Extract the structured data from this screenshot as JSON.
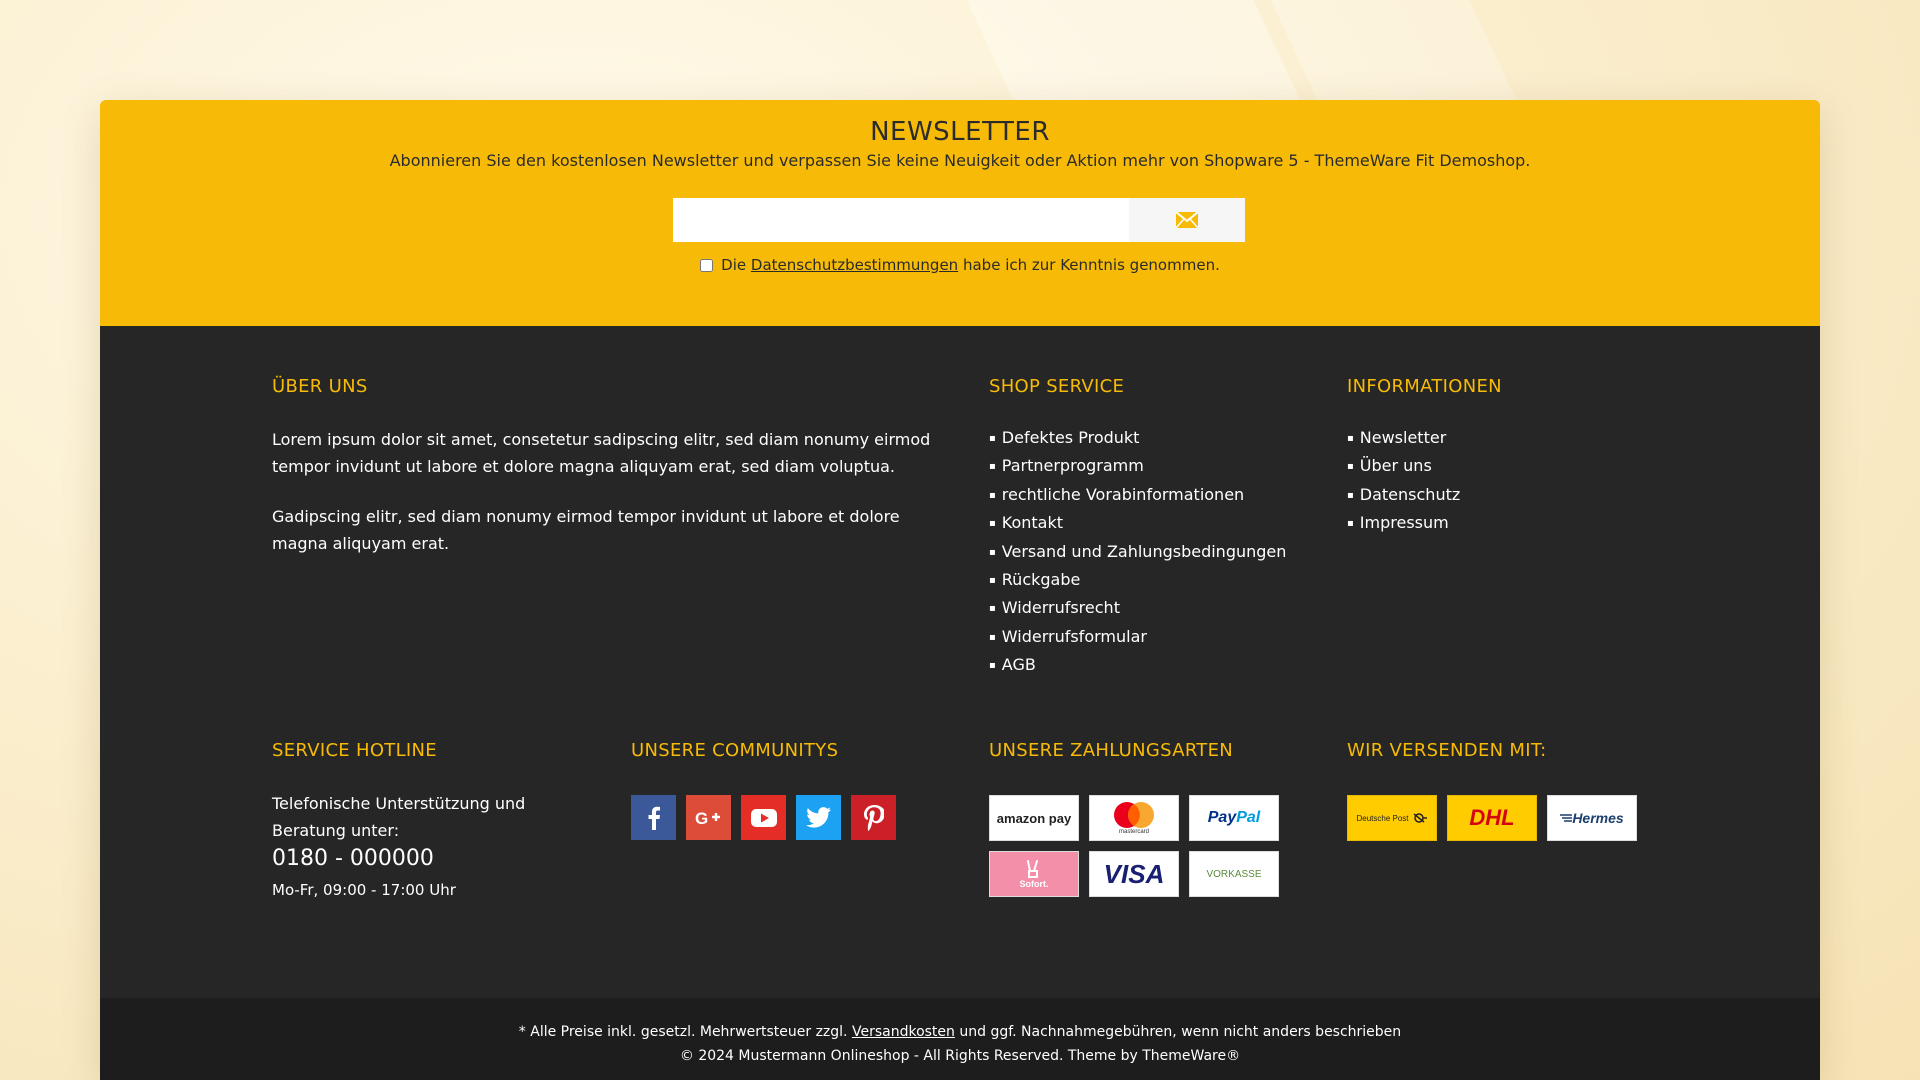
{
  "newsletter": {
    "title": "NEWSLETTER",
    "subtitle": "Abonnieren Sie den kostenlosen Newsletter und verpassen Sie keine Neuigkeit oder Aktion mehr von Shopware 5 - ThemeWare Fit Demoshop.",
    "email_value": "",
    "submit_icon": "envelope-icon",
    "consent_prefix": "Die",
    "consent_link": "Datenschutzbestimmungen",
    "consent_suffix": "habe ich zur Kenntnis genommen."
  },
  "about": {
    "title": "ÜBER UNS",
    "paragraph1": "Lorem ipsum dolor sit amet, consetetur sadipscing elitr, sed diam nonumy eirmod tempor invidunt ut labore et dolore magna aliquyam erat, sed diam voluptua.",
    "paragraph2": "Gadipscing elitr, sed diam nonumy eirmod tempor invidunt ut labore et dolore magna aliquyam erat."
  },
  "shop_service": {
    "title": "SHOP SERVICE",
    "links": [
      "Defektes Produkt",
      "Partnerprogramm",
      "rechtliche Vorabinformationen",
      "Kontakt",
      "Versand und Zahlungsbedingungen",
      "Rückgabe",
      "Widerrufsrecht",
      "Widerrufsformular",
      "AGB"
    ]
  },
  "informationen": {
    "title": "INFORMATIONEN",
    "links": [
      "Newsletter",
      "Über uns",
      "Datenschutz",
      "Impressum"
    ]
  },
  "hotline": {
    "title": "SERVICE HOTLINE",
    "text": "Telefonische Unterstützung und Beratung unter:",
    "phone": "0180 - 000000",
    "hours": "Mo-Fr, 09:00 - 17:00 Uhr"
  },
  "communities": {
    "title": "UNSERE COMMUNITYS",
    "icons": [
      {
        "name": "facebook-icon",
        "color": "#3b5998"
      },
      {
        "name": "google-plus-icon",
        "color": "#dd4b39"
      },
      {
        "name": "youtube-icon",
        "color": "#e52d27"
      },
      {
        "name": "twitter-icon",
        "color": "#1da1f2"
      },
      {
        "name": "pinterest-icon",
        "color": "#cb2027"
      }
    ]
  },
  "payments": {
    "title": "UNSERE ZAHLUNGSARTEN",
    "amazon": "amazon pay",
    "mastercard": "mastercard",
    "paypal_pay": "Pay",
    "paypal_pal": "Pal",
    "sofort": "Sofort.",
    "visa": "VISA",
    "vorkasse": "VORKASSE"
  },
  "shipping": {
    "title": "WIR VERSENDEN MIT:",
    "deutsche_post": "Deutsche Post",
    "dhl": "DHL",
    "hermes": "Hermes"
  },
  "bottom": {
    "line1_prefix": "* Alle Preise inkl. gesetzl. Mehrwertsteuer zzgl.",
    "line1_link": "Versandkosten",
    "line1_suffix": "und ggf. Nachnahmegebühren, wenn nicht anders beschrieben",
    "line2": "© 2024 Mustermann Onlineshop - All Rights Reserved. Theme by ThemeWare®"
  },
  "colors": {
    "accent": "#f7bb07",
    "footer_bg": "#262626",
    "bottom_bg": "#1d1d1d"
  }
}
